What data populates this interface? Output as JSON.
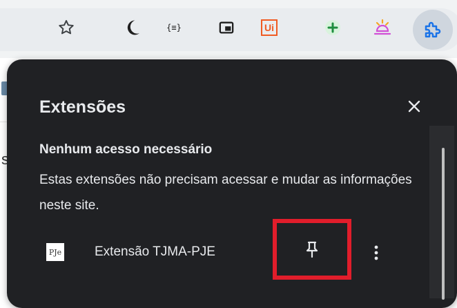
{
  "toolbar": {
    "icons": [
      "star-icon",
      "moon-icon",
      "json-formatter-icon",
      "picture-in-picture-icon",
      "uipath-icon",
      "add-green-icon",
      "weather-icon",
      "extensions-puzzle-icon"
    ],
    "uipath_label": "Ui",
    "json_label": "{≡}"
  },
  "background_page": {
    "side_letter": "s"
  },
  "extensions_panel": {
    "title": "Extensões",
    "close_icon": "close-icon",
    "section": {
      "heading": "Nenhum acesso necessário",
      "description": "Estas extensões não precisam acessar e mudar as informações neste site."
    },
    "extensions": [
      {
        "icon_label": "PJe",
        "name": "Extensão TJMA-PJE",
        "pin_icon": "pin-icon",
        "more_icon": "more-vertical-icon"
      }
    ]
  },
  "colors": {
    "panel_bg": "#202124",
    "text": "#e8eaed",
    "highlight": "#e11d2b",
    "toolbar_bg": "#f1f3f4"
  }
}
